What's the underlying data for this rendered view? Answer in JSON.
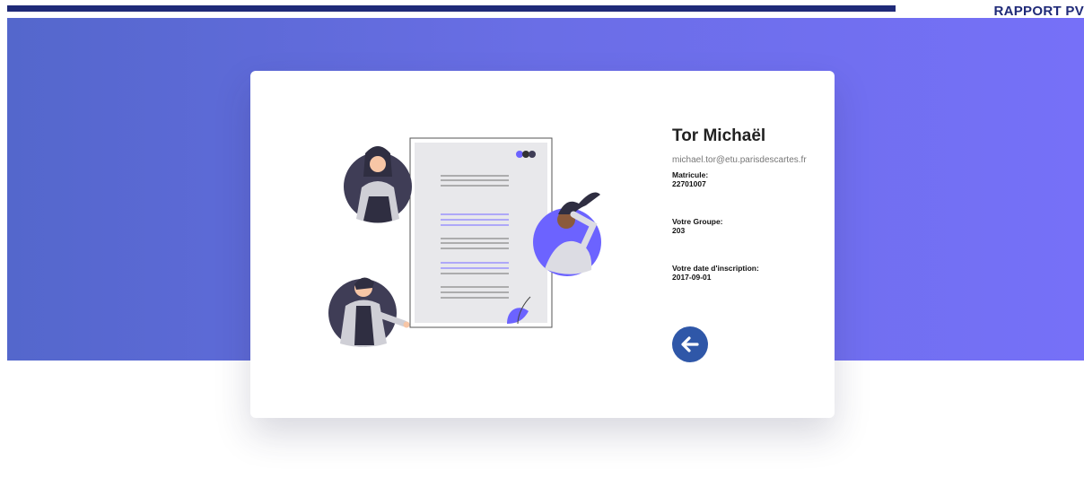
{
  "document": {
    "header": "RAPPORT PV"
  },
  "profile": {
    "name": "Tor Michaël",
    "email": "michael.tor@etu.parisdescartes.fr",
    "matricule_label": "Matricule:",
    "matricule": "22701007",
    "groupe_label": "Votre Groupe:",
    "groupe": "203",
    "date_label": "Votre date d'inscription:",
    "date": "2017-09-01"
  },
  "icons": {
    "back": "arrow-left-circle-icon",
    "illustration": "resume-people-illustration"
  },
  "colors": {
    "hero_start": "#5467cc",
    "hero_end": "#7670f8",
    "accent": "#6c63ff",
    "back_button": "#2f57a8",
    "doc_bar": "#1f2a78"
  }
}
